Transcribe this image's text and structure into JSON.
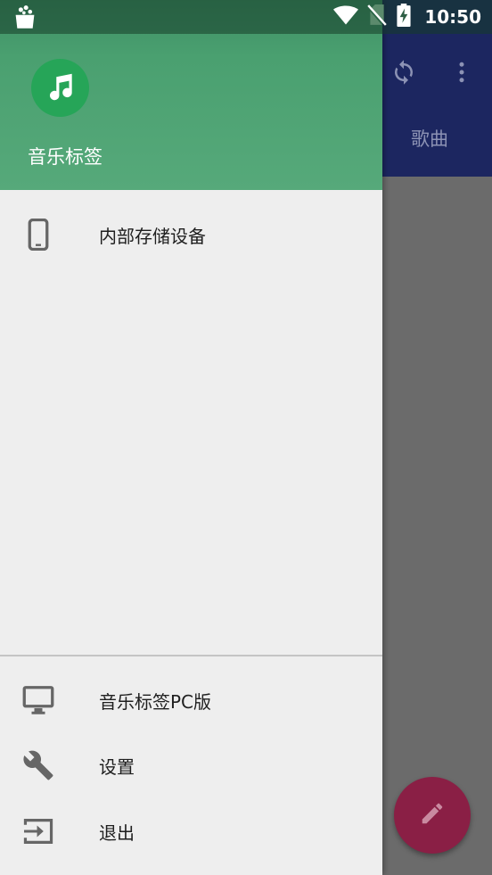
{
  "status_bar": {
    "time": "10:50",
    "icons": [
      "app-notification-icon",
      "wifi-icon",
      "no-sim-icon",
      "battery-charging-icon"
    ]
  },
  "background_app": {
    "toolbar_icons": [
      "sync-icon",
      "more-vert-icon"
    ],
    "tab_label": "歌曲",
    "fab_icon": "edit-icon",
    "fab_color": "#8a1f45",
    "toolbar_color": "#1c2660"
  },
  "drawer": {
    "header": {
      "app_name": "音乐标签",
      "logo_icon": "music-note-icon",
      "logo_color": "#26a558"
    },
    "storage_items": [
      {
        "label": "内部存储设备",
        "icon": "phone-icon"
      }
    ],
    "footer_items": [
      {
        "label": "音乐标签PC版",
        "icon": "desktop-icon"
      },
      {
        "label": "设置",
        "icon": "wrench-icon"
      },
      {
        "label": "退出",
        "icon": "exit-icon"
      }
    ]
  }
}
